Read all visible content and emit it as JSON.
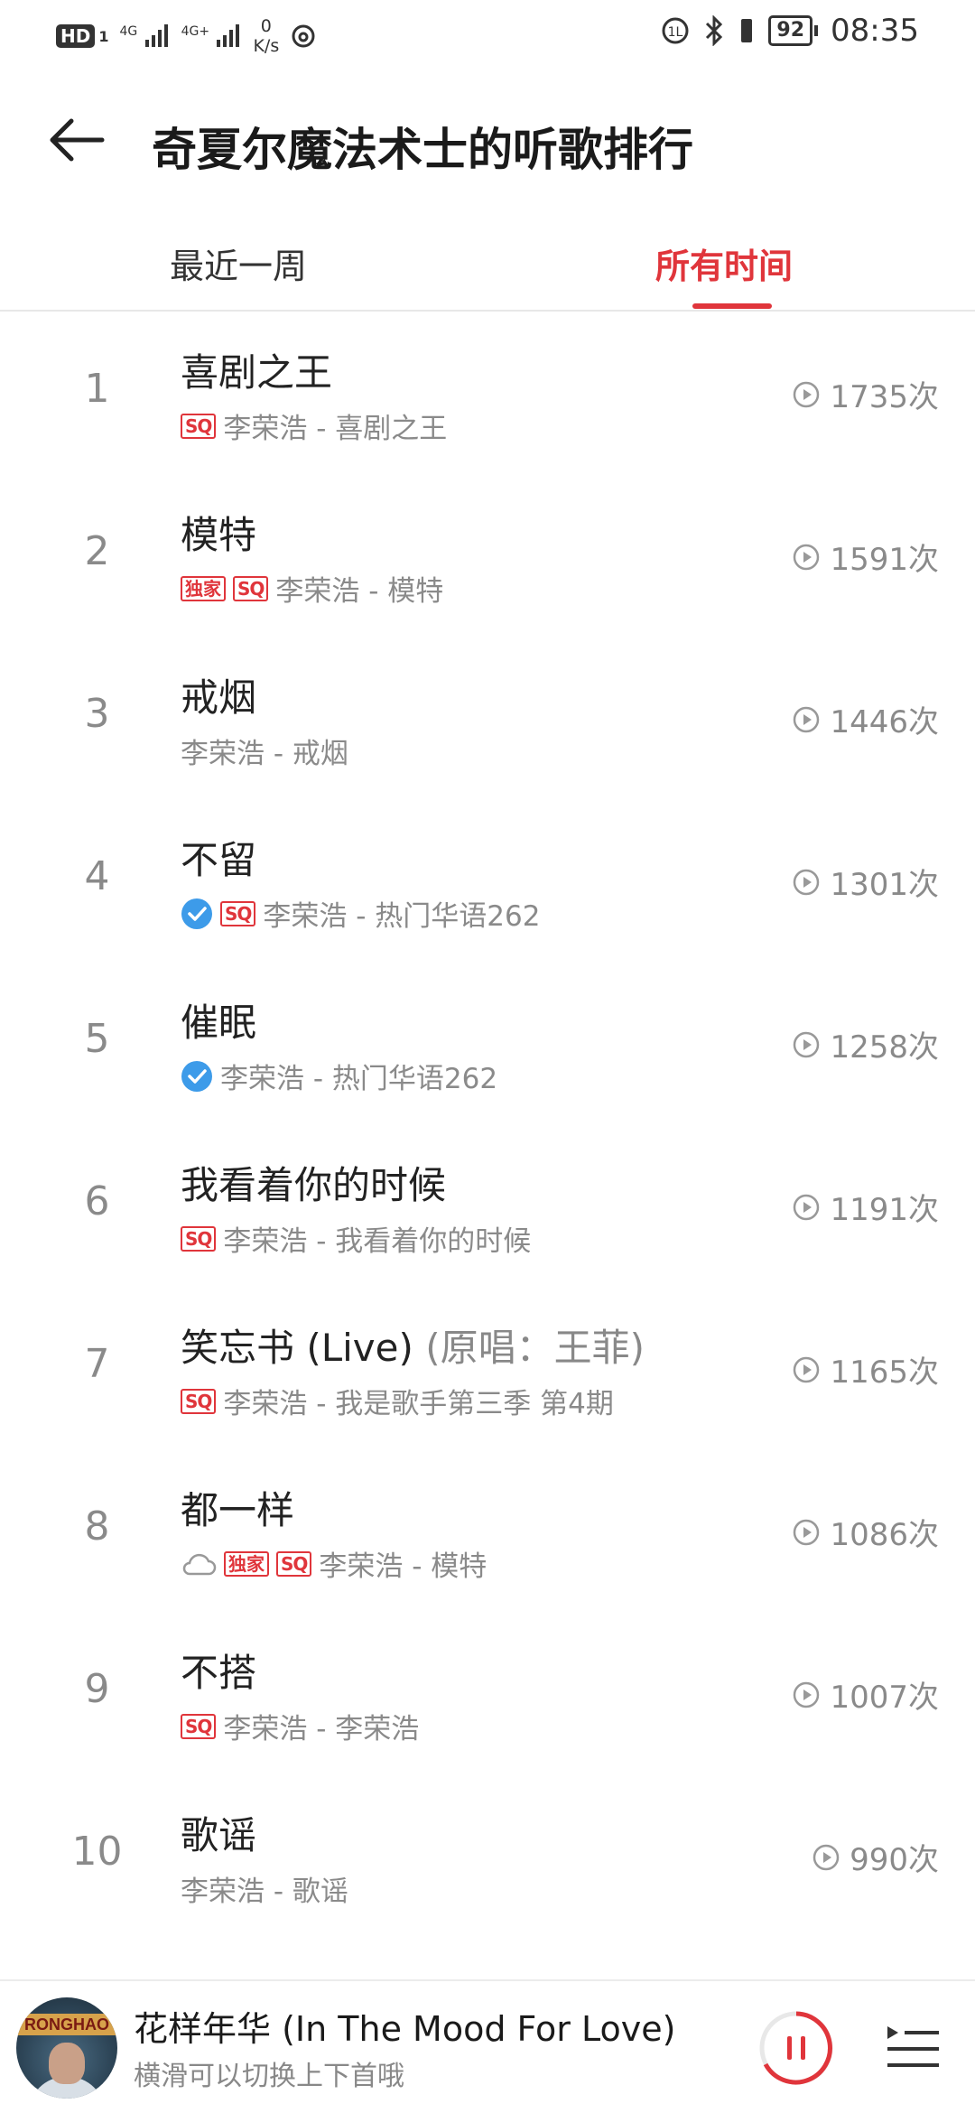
{
  "status_bar": {
    "hd": "HD",
    "hd_sub": "1",
    "net1": "4G",
    "net2": "4G+",
    "speed_value": "0",
    "speed_unit": "K/s",
    "battery": "92",
    "time": "08:35"
  },
  "header": {
    "title": "奇夏尔魔法术士的听歌排行"
  },
  "tabs": [
    {
      "label": "最近一周",
      "active": false
    },
    {
      "label": "所有时间",
      "active": true
    }
  ],
  "tags": {
    "sq": "SQ",
    "exclusive": "独家"
  },
  "count_suffix": "次",
  "songs": [
    {
      "rank": "1",
      "title": "喜剧之王",
      "original": "",
      "artist_album": "李荣浩 - 喜剧之王",
      "plays": "1735次"
    },
    {
      "rank": "2",
      "title": "模特",
      "original": "",
      "artist_album": "李荣浩 - 模特",
      "plays": "1591次"
    },
    {
      "rank": "3",
      "title": "戒烟",
      "original": "",
      "artist_album": "李荣浩 - 戒烟",
      "plays": "1446次"
    },
    {
      "rank": "4",
      "title": "不留",
      "original": "",
      "artist_album": "李荣浩 - 热门华语262",
      "plays": "1301次"
    },
    {
      "rank": "5",
      "title": "催眠",
      "original": "",
      "artist_album": "李荣浩 - 热门华语262",
      "plays": "1258次"
    },
    {
      "rank": "6",
      "title": "我看着你的时候",
      "original": "",
      "artist_album": "李荣浩 - 我看着你的时候",
      "plays": "1191次"
    },
    {
      "rank": "7",
      "title": "笑忘书 (Live)",
      "original": "(原唱：王菲)",
      "artist_album": "李荣浩 - 我是歌手第三季 第4期",
      "plays": "1165次"
    },
    {
      "rank": "8",
      "title": "都一样",
      "original": "",
      "artist_album": "李荣浩 - 模特",
      "plays": "1086次"
    },
    {
      "rank": "9",
      "title": "不搭",
      "original": "",
      "artist_album": "李荣浩 - 李荣浩",
      "plays": "1007次"
    },
    {
      "rank": "10",
      "title": "歌谣",
      "original": "",
      "artist_album": "李荣浩 - 歌谣",
      "plays": "990次"
    }
  ],
  "player": {
    "cover_text": "RONGHAO",
    "title": "花样年华 (In The Mood For Love)",
    "subtitle": "横滑可以切换上下首哦"
  },
  "colors": {
    "accent": "#e0353b",
    "secondary_text": "#8a8a8a",
    "verified": "#3d9be9"
  }
}
